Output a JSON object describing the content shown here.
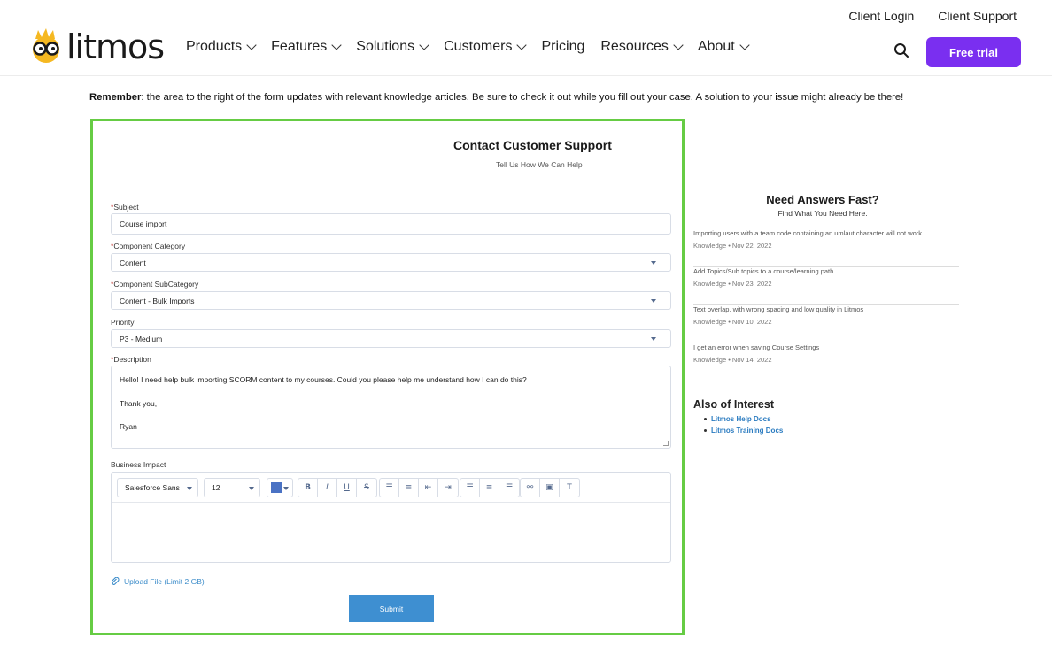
{
  "header": {
    "client_login": "Client Login",
    "client_support": "Client Support",
    "logo_text": "litmos",
    "nav": [
      "Products",
      "Features",
      "Solutions",
      "Customers",
      "Pricing",
      "Resources",
      "About"
    ],
    "cta": "Free trial"
  },
  "remember": {
    "bold": "Remember",
    "text": ": the area to the right of the form updates with relevant knowledge articles. Be sure to check it out while you fill out your case. A solution to your issue might already be there!"
  },
  "form": {
    "title": "Contact Customer Support",
    "subtitle": "Tell Us How We Can Help",
    "subject_label": "Subject",
    "subject_value": "Course import",
    "category_label": "Component Category",
    "category_value": "Content",
    "subcategory_label": "Component SubCategory",
    "subcategory_value": "Content - Bulk Imports",
    "priority_label": "Priority",
    "priority_value": "P3 - Medium",
    "description_label": "Description",
    "description_lines": [
      "Hello! I need help bulk importing SCORM content to my courses. Could you please help me understand how I can do this?",
      "Thank you,",
      "Ryan"
    ],
    "impact_label": "Business Impact",
    "font_value": "Salesforce Sans",
    "size_value": "12",
    "upload": "Upload File (Limit 2 GB)",
    "submit": "Submit",
    "accent_color": "#4a72c4"
  },
  "sidebar": {
    "title": "Need Answers Fast?",
    "subtitle": "Find What You Need Here.",
    "articles": [
      {
        "title": "Importing users with a team code containing an umlaut character will not work",
        "meta": "Knowledge  •  Nov 22, 2022"
      },
      {
        "title": "Add Topics/Sub topics to a course/learning path",
        "meta": "Knowledge  •  Nov 23, 2022"
      },
      {
        "title": "Text overlap, with wrong spacing and low quality in Litmos",
        "meta": "Knowledge  •  Nov 10, 2022"
      },
      {
        "title": "I get an error when saving Course Settings",
        "meta": "Knowledge  •  Nov 14, 2022"
      }
    ],
    "also_title": "Also of Interest",
    "links": [
      "Litmos Help Docs",
      "Litmos Training Docs"
    ]
  }
}
